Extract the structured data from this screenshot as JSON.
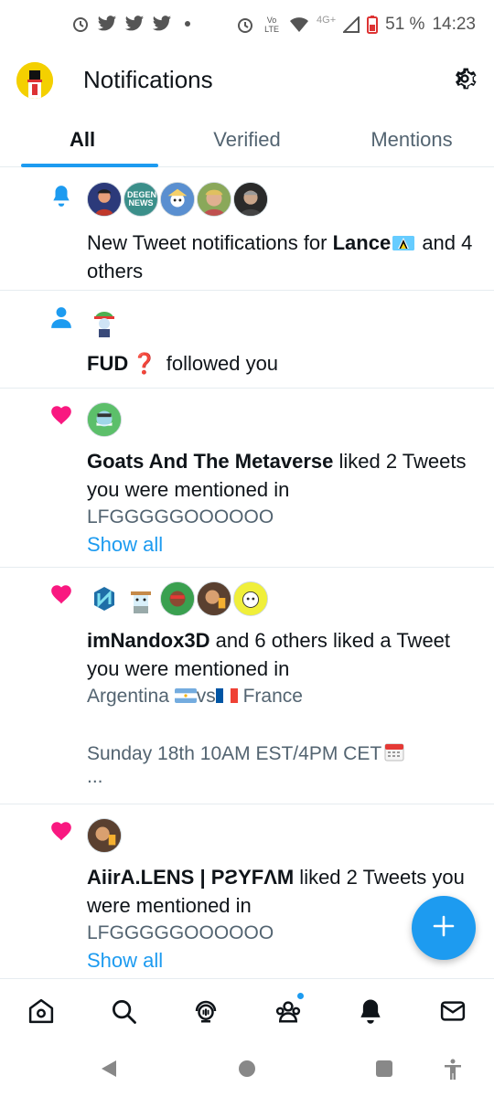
{
  "status_bar": {
    "battery": "51 %",
    "time": "14:23",
    "network": "4G+",
    "volte": "Vo LTE"
  },
  "header": {
    "title": "Notifications"
  },
  "tabs": [
    {
      "label": "All",
      "active": true
    },
    {
      "label": "Verified",
      "active": false
    },
    {
      "label": "Mentions",
      "active": false
    }
  ],
  "notifications": [
    {
      "type": "bell",
      "avatar_text": [
        "",
        "DEGEN NEWS",
        "",
        "",
        ""
      ],
      "text_prefix": "New Tweet notifications for ",
      "name": "Lance",
      "text_suffix": " and 4 others"
    },
    {
      "type": "follow",
      "name": "FUD",
      "name_emoji": "❓",
      "text": " followed you"
    },
    {
      "type": "like",
      "name": "Goats And The Metaverse",
      "text": " liked 2 Tweets you were mentioned in",
      "sub": "LFGGGGGOOOOOO",
      "action": "Show all"
    },
    {
      "type": "like",
      "name": "imNandox3D",
      "text": " and 6 others liked a Tweet you were mentioned in",
      "sub_line1_a": "Argentina ",
      "sub_line1_b": "vs",
      "sub_line1_c": " France",
      "sub_line2": "Sunday 18th 10AM EST/4PM CET",
      "sub_line3": "..."
    },
    {
      "type": "like",
      "name": "AiirA.LENS | PƧYFΛM",
      "text": " liked 2 Tweets you were mentioned in",
      "sub": "LFGGGGGOOOOOO",
      "action": "Show all"
    }
  ],
  "colors": {
    "accent": "#1d9bf0",
    "like": "#f91880",
    "text": "#0f1419",
    "secondary": "#536471"
  },
  "icons": {
    "bottom_nav": [
      "home-icon",
      "search-icon",
      "spaces-icon",
      "communities-icon",
      "notifications-icon",
      "messages-icon"
    ],
    "system_nav": [
      "back-icon",
      "home-circle-icon",
      "recents-icon",
      "accessibility-icon"
    ]
  }
}
